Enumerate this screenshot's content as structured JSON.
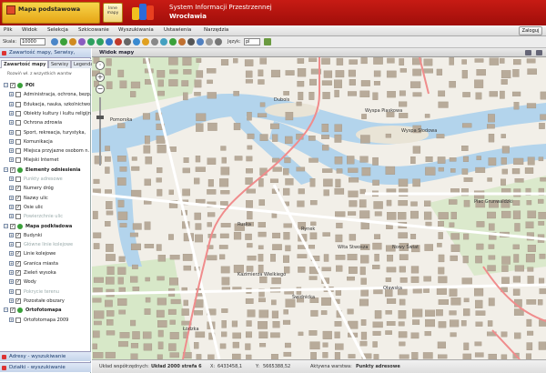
{
  "header": {
    "basemap_title": "Mapa podstawowa",
    "other_maps_label": "Inne mapy",
    "system_title": "System Informacji Przestrzennej",
    "city": "Wrocławia",
    "login_label": "Zaloguj"
  },
  "menu": [
    "Plik",
    "Widok",
    "Selekcja",
    "Szkicowanie",
    "Wyszukiwania",
    "Ustawienia",
    "Narzędzia"
  ],
  "toolbar": {
    "scale_label": "Skala:",
    "scale_value": "10000",
    "language_label": "Język:",
    "language_value": "pl"
  },
  "left_panel": {
    "title": "Zawartość mapy, Serwisy,",
    "tabs": [
      "Zawartość mapy",
      "Serwisy",
      "Legenda"
    ],
    "expand_all": "Rozwiń wł. z wszystkich warstw",
    "tree": [
      {
        "label": "POI",
        "kind": "group"
      },
      {
        "label": "Administracja, ochrona, bezp.",
        "kind": "item"
      },
      {
        "label": "Edukacja, nauka, szkolnictwo",
        "kind": "item"
      },
      {
        "label": "Obiekty kultury i kultu religijn.",
        "kind": "item"
      },
      {
        "label": "Ochrona zdrowia",
        "kind": "item"
      },
      {
        "label": "Sport, rekreacja, turystyka,",
        "kind": "item"
      },
      {
        "label": "Komunikacja",
        "kind": "item"
      },
      {
        "label": "Miejsca przyjazne osobom n.",
        "kind": "item"
      },
      {
        "label": "Miejski Internet",
        "kind": "item"
      },
      {
        "label": "Elementy odniesienia",
        "kind": "group"
      },
      {
        "label": "Punkty adresowe",
        "kind": "dim"
      },
      {
        "label": "Numery dróg",
        "kind": "checked"
      },
      {
        "label": "Nazwy ulic",
        "kind": "checked"
      },
      {
        "label": "Osie ulic",
        "kind": "checked"
      },
      {
        "label": "Powierzchnie ulic",
        "kind": "dim"
      },
      {
        "label": "Mapa podkładowa",
        "kind": "group"
      },
      {
        "label": "Budynki",
        "kind": "checked"
      },
      {
        "label": "Główne linie kolejowe",
        "kind": "dim"
      },
      {
        "label": "Linie kolejowe",
        "kind": "checked"
      },
      {
        "label": "Granica miasta",
        "kind": "checked"
      },
      {
        "label": "Zieleń wysoka",
        "kind": "checked"
      },
      {
        "label": "Wody",
        "kind": "checked"
      },
      {
        "label": "Pokrycie terenu",
        "kind": "dim"
      },
      {
        "label": "Pozostałe obszary",
        "kind": "checked"
      },
      {
        "label": "Ortofotomapa",
        "kind": "group"
      },
      {
        "label": "Ortofotomapa 2009",
        "kind": "item"
      }
    ],
    "bottom_tabs": [
      "Adresy - wyszukiwanie",
      "Działki - wyszukiwanie"
    ]
  },
  "map": {
    "title": "Widok mapy",
    "streets": [
      "Dubois",
      "Pomorska",
      "Wyspa Słodowa",
      "Wyspa Piaskowa",
      "Plac Grunwaldzki",
      "Rynek",
      "Ruska",
      "Świdnicka",
      "Oławska",
      "Kazimierza Wielkiego",
      "Nowy Świat",
      "Wita Stwosza",
      "Łódzka"
    ]
  },
  "status": {
    "coords_label": "Układ współrzędnych:",
    "coords_value": "Układ 2000 strefa 6",
    "x_label": "X:",
    "x_value": "6433458,1",
    "y_label": "Y:",
    "y_value": "5665388,52",
    "active_label": "Aktywna warstwa:",
    "active_value": "Punkty adresowe"
  }
}
